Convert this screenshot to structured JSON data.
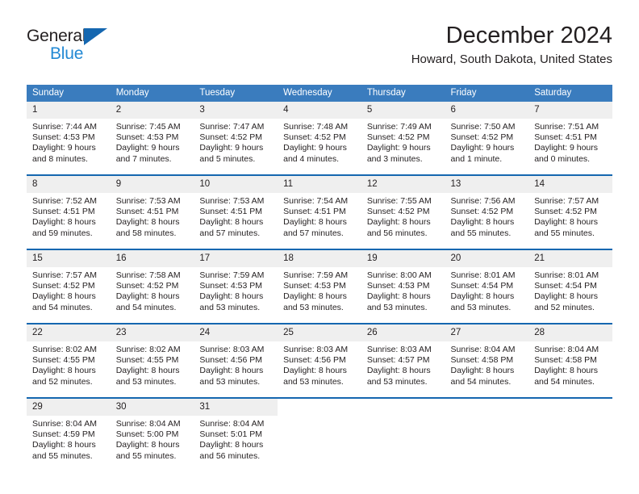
{
  "brand": {
    "name_part1": "General",
    "name_part2": "Blue",
    "color_dark": "#231f20",
    "color_blue": "#2389d4",
    "triangle_color": "#1567b0"
  },
  "header": {
    "title": "December 2024",
    "location": "Howard, South Dakota, United States"
  },
  "theme": {
    "header_bg": "#3a7cbe",
    "daynum_bg": "#efefef",
    "separator": "#1567b0"
  },
  "weekdays": [
    "Sunday",
    "Monday",
    "Tuesday",
    "Wednesday",
    "Thursday",
    "Friday",
    "Saturday"
  ],
  "weeks": [
    [
      {
        "day": "1",
        "sunrise": "Sunrise: 7:44 AM",
        "sunset": "Sunset: 4:53 PM",
        "daylight1": "Daylight: 9 hours",
        "daylight2": "and 8 minutes."
      },
      {
        "day": "2",
        "sunrise": "Sunrise: 7:45 AM",
        "sunset": "Sunset: 4:53 PM",
        "daylight1": "Daylight: 9 hours",
        "daylight2": "and 7 minutes."
      },
      {
        "day": "3",
        "sunrise": "Sunrise: 7:47 AM",
        "sunset": "Sunset: 4:52 PM",
        "daylight1": "Daylight: 9 hours",
        "daylight2": "and 5 minutes."
      },
      {
        "day": "4",
        "sunrise": "Sunrise: 7:48 AM",
        "sunset": "Sunset: 4:52 PM",
        "daylight1": "Daylight: 9 hours",
        "daylight2": "and 4 minutes."
      },
      {
        "day": "5",
        "sunrise": "Sunrise: 7:49 AM",
        "sunset": "Sunset: 4:52 PM",
        "daylight1": "Daylight: 9 hours",
        "daylight2": "and 3 minutes."
      },
      {
        "day": "6",
        "sunrise": "Sunrise: 7:50 AM",
        "sunset": "Sunset: 4:52 PM",
        "daylight1": "Daylight: 9 hours",
        "daylight2": "and 1 minute."
      },
      {
        "day": "7",
        "sunrise": "Sunrise: 7:51 AM",
        "sunset": "Sunset: 4:51 PM",
        "daylight1": "Daylight: 9 hours",
        "daylight2": "and 0 minutes."
      }
    ],
    [
      {
        "day": "8",
        "sunrise": "Sunrise: 7:52 AM",
        "sunset": "Sunset: 4:51 PM",
        "daylight1": "Daylight: 8 hours",
        "daylight2": "and 59 minutes."
      },
      {
        "day": "9",
        "sunrise": "Sunrise: 7:53 AM",
        "sunset": "Sunset: 4:51 PM",
        "daylight1": "Daylight: 8 hours",
        "daylight2": "and 58 minutes."
      },
      {
        "day": "10",
        "sunrise": "Sunrise: 7:53 AM",
        "sunset": "Sunset: 4:51 PM",
        "daylight1": "Daylight: 8 hours",
        "daylight2": "and 57 minutes."
      },
      {
        "day": "11",
        "sunrise": "Sunrise: 7:54 AM",
        "sunset": "Sunset: 4:51 PM",
        "daylight1": "Daylight: 8 hours",
        "daylight2": "and 57 minutes."
      },
      {
        "day": "12",
        "sunrise": "Sunrise: 7:55 AM",
        "sunset": "Sunset: 4:52 PM",
        "daylight1": "Daylight: 8 hours",
        "daylight2": "and 56 minutes."
      },
      {
        "day": "13",
        "sunrise": "Sunrise: 7:56 AM",
        "sunset": "Sunset: 4:52 PM",
        "daylight1": "Daylight: 8 hours",
        "daylight2": "and 55 minutes."
      },
      {
        "day": "14",
        "sunrise": "Sunrise: 7:57 AM",
        "sunset": "Sunset: 4:52 PM",
        "daylight1": "Daylight: 8 hours",
        "daylight2": "and 55 minutes."
      }
    ],
    [
      {
        "day": "15",
        "sunrise": "Sunrise: 7:57 AM",
        "sunset": "Sunset: 4:52 PM",
        "daylight1": "Daylight: 8 hours",
        "daylight2": "and 54 minutes."
      },
      {
        "day": "16",
        "sunrise": "Sunrise: 7:58 AM",
        "sunset": "Sunset: 4:52 PM",
        "daylight1": "Daylight: 8 hours",
        "daylight2": "and 54 minutes."
      },
      {
        "day": "17",
        "sunrise": "Sunrise: 7:59 AM",
        "sunset": "Sunset: 4:53 PM",
        "daylight1": "Daylight: 8 hours",
        "daylight2": "and 53 minutes."
      },
      {
        "day": "18",
        "sunrise": "Sunrise: 7:59 AM",
        "sunset": "Sunset: 4:53 PM",
        "daylight1": "Daylight: 8 hours",
        "daylight2": "and 53 minutes."
      },
      {
        "day": "19",
        "sunrise": "Sunrise: 8:00 AM",
        "sunset": "Sunset: 4:53 PM",
        "daylight1": "Daylight: 8 hours",
        "daylight2": "and 53 minutes."
      },
      {
        "day": "20",
        "sunrise": "Sunrise: 8:01 AM",
        "sunset": "Sunset: 4:54 PM",
        "daylight1": "Daylight: 8 hours",
        "daylight2": "and 53 minutes."
      },
      {
        "day": "21",
        "sunrise": "Sunrise: 8:01 AM",
        "sunset": "Sunset: 4:54 PM",
        "daylight1": "Daylight: 8 hours",
        "daylight2": "and 52 minutes."
      }
    ],
    [
      {
        "day": "22",
        "sunrise": "Sunrise: 8:02 AM",
        "sunset": "Sunset: 4:55 PM",
        "daylight1": "Daylight: 8 hours",
        "daylight2": "and 52 minutes."
      },
      {
        "day": "23",
        "sunrise": "Sunrise: 8:02 AM",
        "sunset": "Sunset: 4:55 PM",
        "daylight1": "Daylight: 8 hours",
        "daylight2": "and 53 minutes."
      },
      {
        "day": "24",
        "sunrise": "Sunrise: 8:03 AM",
        "sunset": "Sunset: 4:56 PM",
        "daylight1": "Daylight: 8 hours",
        "daylight2": "and 53 minutes."
      },
      {
        "day": "25",
        "sunrise": "Sunrise: 8:03 AM",
        "sunset": "Sunset: 4:56 PM",
        "daylight1": "Daylight: 8 hours",
        "daylight2": "and 53 minutes."
      },
      {
        "day": "26",
        "sunrise": "Sunrise: 8:03 AM",
        "sunset": "Sunset: 4:57 PM",
        "daylight1": "Daylight: 8 hours",
        "daylight2": "and 53 minutes."
      },
      {
        "day": "27",
        "sunrise": "Sunrise: 8:04 AM",
        "sunset": "Sunset: 4:58 PM",
        "daylight1": "Daylight: 8 hours",
        "daylight2": "and 54 minutes."
      },
      {
        "day": "28",
        "sunrise": "Sunrise: 8:04 AM",
        "sunset": "Sunset: 4:58 PM",
        "daylight1": "Daylight: 8 hours",
        "daylight2": "and 54 minutes."
      }
    ],
    [
      {
        "day": "29",
        "sunrise": "Sunrise: 8:04 AM",
        "sunset": "Sunset: 4:59 PM",
        "daylight1": "Daylight: 8 hours",
        "daylight2": "and 55 minutes."
      },
      {
        "day": "30",
        "sunrise": "Sunrise: 8:04 AM",
        "sunset": "Sunset: 5:00 PM",
        "daylight1": "Daylight: 8 hours",
        "daylight2": "and 55 minutes."
      },
      {
        "day": "31",
        "sunrise": "Sunrise: 8:04 AM",
        "sunset": "Sunset: 5:01 PM",
        "daylight1": "Daylight: 8 hours",
        "daylight2": "and 56 minutes."
      },
      {
        "day": "",
        "sunrise": "",
        "sunset": "",
        "daylight1": "",
        "daylight2": ""
      },
      {
        "day": "",
        "sunrise": "",
        "sunset": "",
        "daylight1": "",
        "daylight2": ""
      },
      {
        "day": "",
        "sunrise": "",
        "sunset": "",
        "daylight1": "",
        "daylight2": ""
      },
      {
        "day": "",
        "sunrise": "",
        "sunset": "",
        "daylight1": "",
        "daylight2": ""
      }
    ]
  ]
}
